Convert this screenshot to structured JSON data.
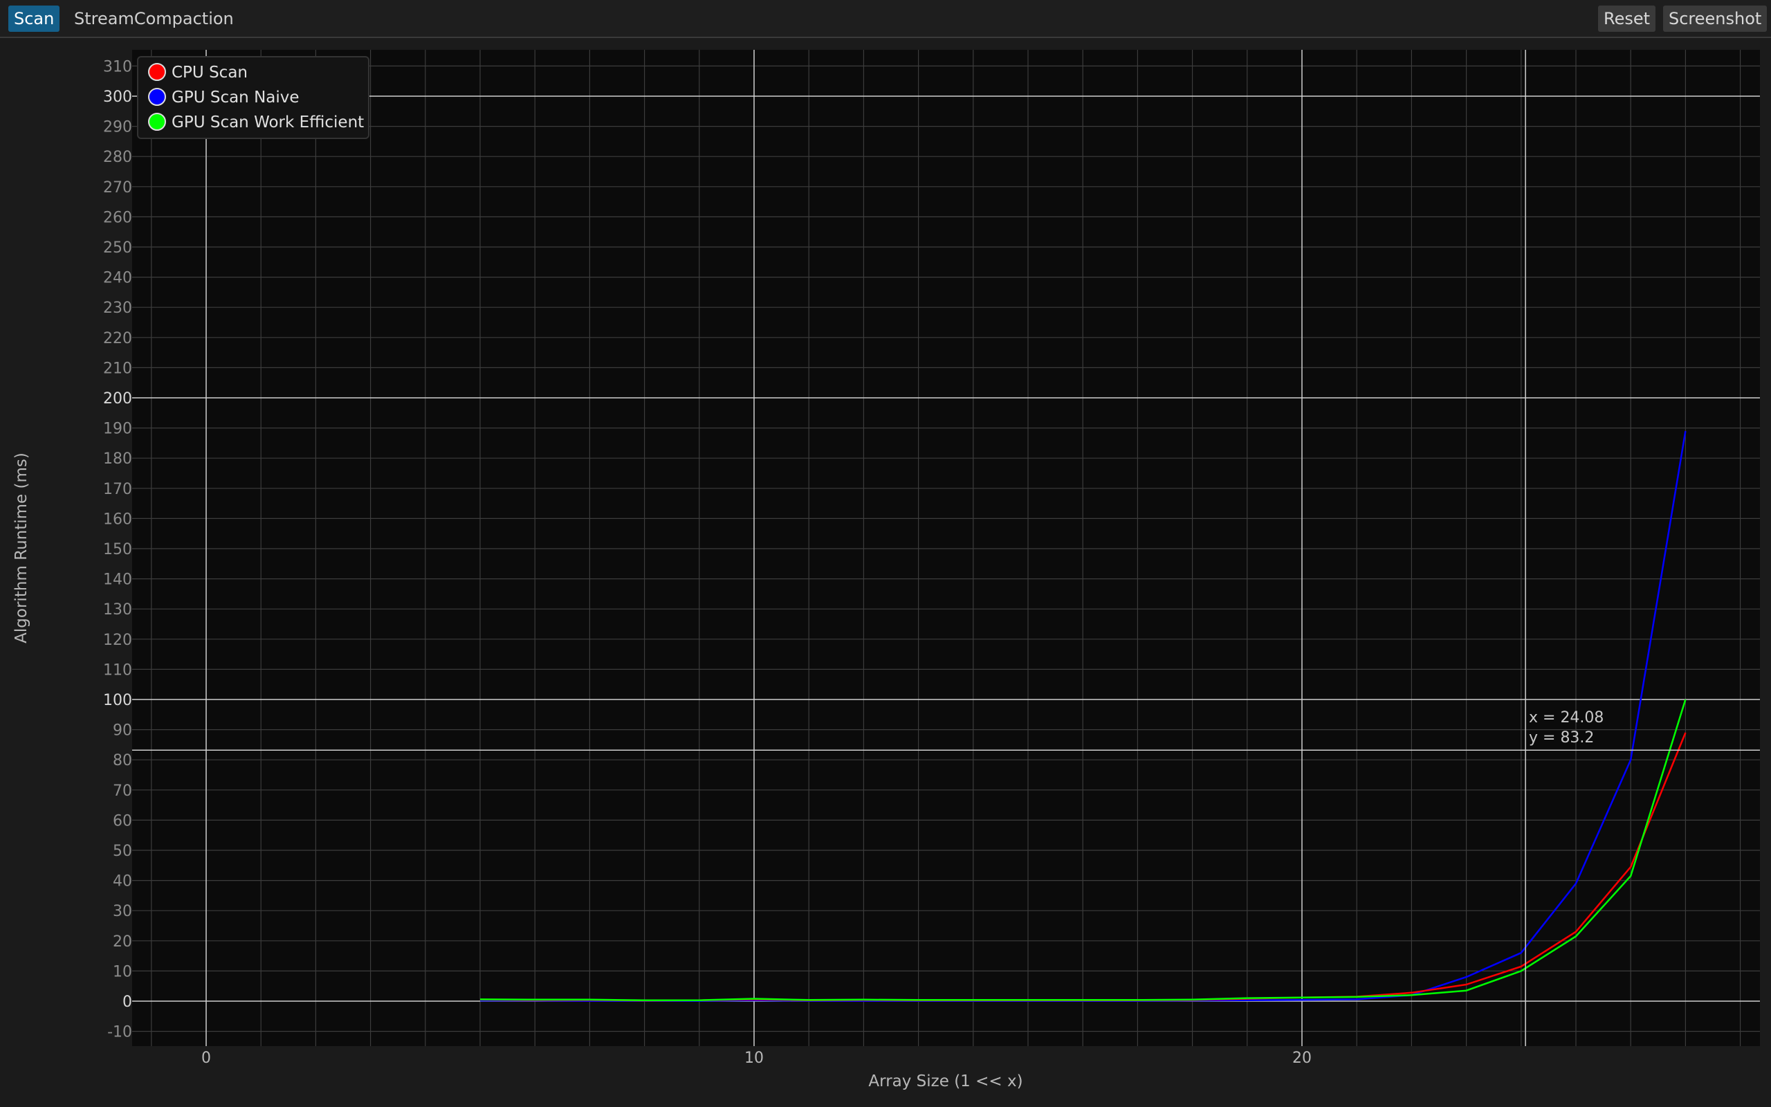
{
  "menubar": {
    "tabs": [
      {
        "label": "Scan",
        "active": true
      },
      {
        "label": "StreamCompaction",
        "active": false
      }
    ],
    "reset_label": "Reset",
    "screenshot_label": "Screenshot"
  },
  "cursor": {
    "x_text": "x = 24.08",
    "y_text": "y = 83.2",
    "x": 24.08,
    "y": 83.2
  },
  "chart_data": {
    "type": "line",
    "xlabel": "Array Size (1 << x)",
    "ylabel": "Algorithm Runtime (ms)",
    "xlim": [
      -1.3,
      28
    ],
    "ylim": [
      -15,
      315
    ],
    "x_major_ticks": [
      0,
      10,
      20
    ],
    "y_ticks": [
      -10,
      0,
      10,
      20,
      30,
      40,
      50,
      60,
      70,
      80,
      90,
      100,
      110,
      120,
      130,
      140,
      150,
      160,
      170,
      180,
      190,
      200,
      210,
      220,
      230,
      240,
      250,
      260,
      270,
      280,
      290,
      300,
      310
    ],
    "y_major_lines": [
      0,
      100,
      200,
      300
    ],
    "grid": true,
    "legend_position": "top-left",
    "x": [
      5,
      6,
      7,
      8,
      9,
      10,
      11,
      12,
      13,
      14,
      15,
      16,
      17,
      18,
      19,
      20,
      21,
      22,
      23,
      24,
      25,
      26,
      27
    ],
    "series": [
      {
        "name": "CPU Scan",
        "color": "#ff0000",
        "values": [
          0.5,
          0.4,
          0.4,
          0.2,
          0.3,
          0.6,
          0.3,
          0.4,
          0.3,
          0.3,
          0.3,
          0.3,
          0.3,
          0.4,
          0.8,
          1.2,
          1.5,
          2.8,
          5.5,
          11.5,
          23,
          44.5,
          89
        ]
      },
      {
        "name": "GPU Scan Naive",
        "color": "#0000ff",
        "values": [
          0.2,
          0.2,
          0.1,
          0.1,
          0.1,
          0.3,
          0.1,
          0.1,
          0.1,
          0.1,
          0.1,
          0.1,
          0.1,
          0.2,
          0.3,
          0.4,
          0.6,
          2.0,
          8.0,
          16,
          39,
          80,
          189
        ]
      },
      {
        "name": "GPU Scan Work Efficient",
        "color": "#00ff00",
        "values": [
          0.6,
          0.5,
          0.5,
          0.3,
          0.3,
          0.8,
          0.4,
          0.5,
          0.4,
          0.4,
          0.4,
          0.4,
          0.4,
          0.5,
          1.0,
          1.2,
          1.4,
          2.0,
          3.5,
          10,
          21.5,
          41.5,
          100
        ]
      }
    ]
  }
}
